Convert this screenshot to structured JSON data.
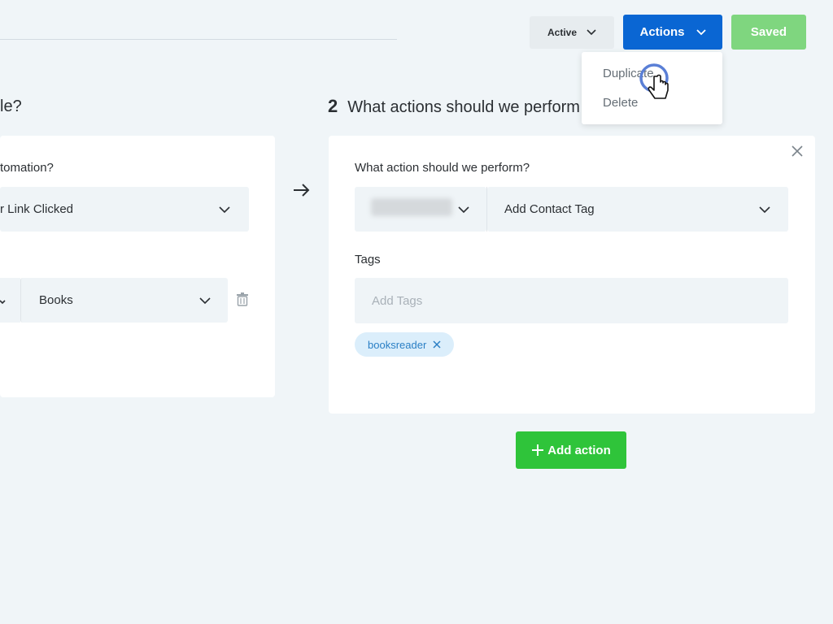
{
  "header": {
    "status_label": "Active",
    "actions_label": "Actions",
    "saved_label": "Saved",
    "actions_menu": [
      "Duplicate",
      "Delete"
    ]
  },
  "trigger": {
    "heading_partial": "le?",
    "question_partial": "tomation?",
    "trigger_value": "r Link Clicked",
    "condition_value": "Books"
  },
  "action_section": {
    "step_number": "2",
    "heading": "What actions should we perform",
    "field_label": "What action should we perform?",
    "action_value": "Add Contact Tag",
    "tags_label": "Tags",
    "tags_placeholder": "Add Tags",
    "tags": [
      "booksreader"
    ],
    "add_action_label": "Add action"
  },
  "colors": {
    "primary": "#0a66d3",
    "success": "#2fc43a",
    "saved": "#7fd67f",
    "background": "#f0f5f8"
  },
  "icons": [
    "chevron-down-icon",
    "close-icon",
    "trash-icon",
    "arrow-right-icon",
    "plus-icon",
    "hand-pointer-icon"
  ]
}
